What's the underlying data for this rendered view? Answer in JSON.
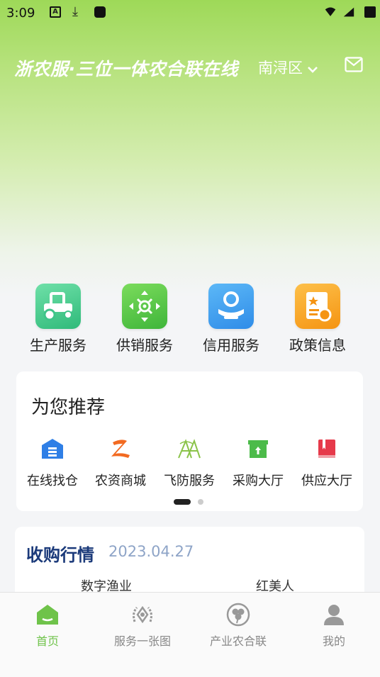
{
  "status_bar": {
    "time": "3:09",
    "icons": [
      "a-notification-icon",
      "download-icon",
      "app-icon",
      "wifi-icon",
      "signal-icon",
      "battery-icon"
    ]
  },
  "header": {
    "title": "浙农服·三位一体农合联在线",
    "region": "南浔区"
  },
  "services": [
    {
      "label": "生产服务",
      "icon": "tractor-icon",
      "color": "#3ec489"
    },
    {
      "label": "供销服务",
      "icon": "distribution-icon",
      "color": "#56c343"
    },
    {
      "label": "信用服务",
      "icon": "credit-icon",
      "color": "#3a9cf0"
    },
    {
      "label": "政策信息",
      "icon": "policy-doc-icon",
      "color": "#f8a51b"
    }
  ],
  "recommend": {
    "title": "为您推荐",
    "items": [
      {
        "label": "在线找仓",
        "icon": "warehouse-icon",
        "color": "#2f7fe6"
      },
      {
        "label": "农资商城",
        "icon": "z-logo-icon",
        "color": "#f26a21"
      },
      {
        "label": "飞防服务",
        "icon": "drone-logo-icon",
        "color": "#8bc34a"
      },
      {
        "label": "采购大厅",
        "icon": "purchase-box-icon",
        "color": "#4cbb4a"
      },
      {
        "label": "供应大厅",
        "icon": "supply-book-icon",
        "color": "#e6394a"
      }
    ]
  },
  "market": {
    "title": "收购行情",
    "date": "2023.04.27",
    "columns": [
      "数字渔业",
      "红美人"
    ]
  },
  "tabbar": [
    {
      "label": "首页",
      "icon": "home-icon",
      "active": true
    },
    {
      "label": "服务一张图",
      "icon": "service-map-icon",
      "active": false
    },
    {
      "label": "产业农合联",
      "icon": "industry-union-icon",
      "active": false
    },
    {
      "label": "我的",
      "icon": "profile-icon",
      "active": false
    }
  ],
  "colors": {
    "accent": "#6fc34a",
    "title_blue": "#1b3a7a"
  }
}
